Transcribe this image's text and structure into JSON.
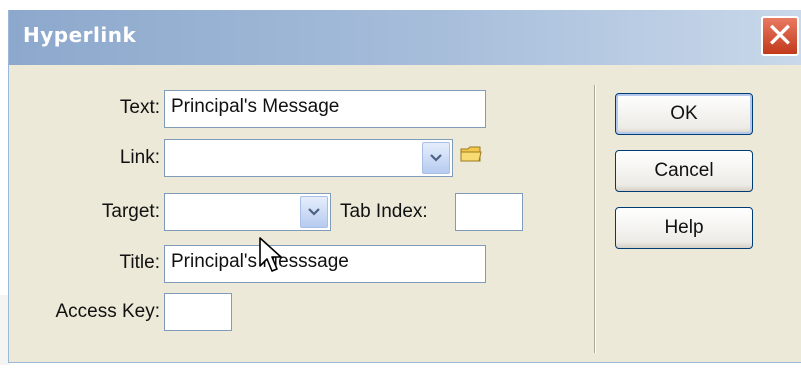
{
  "dialog": {
    "title": "Hyperlink",
    "close_glyph": "✕"
  },
  "form": {
    "text_label": "Text:",
    "text_value": "Principal's Message",
    "link_label": "Link:",
    "link_value": "",
    "target_label": "Target:",
    "target_value": "",
    "tab_index_label": "Tab Index:",
    "tab_index_value": "",
    "title_label": "Title:",
    "title_value": "Principal's Messsage",
    "access_key_label": "Access Key:",
    "access_key_value": ""
  },
  "buttons": {
    "ok": "OK",
    "cancel": "Cancel",
    "help": "Help"
  },
  "icons": {
    "combo_arrow": "chevron-down-icon",
    "browse": "folder-icon",
    "close": "close-icon",
    "cursor": "mouse-cursor-icon"
  },
  "colors": {
    "titlebar": "#8ca8cc",
    "dialog_bg": "#ece9d8",
    "close_red": "#c2391b",
    "field_border": "#7f9db9"
  }
}
